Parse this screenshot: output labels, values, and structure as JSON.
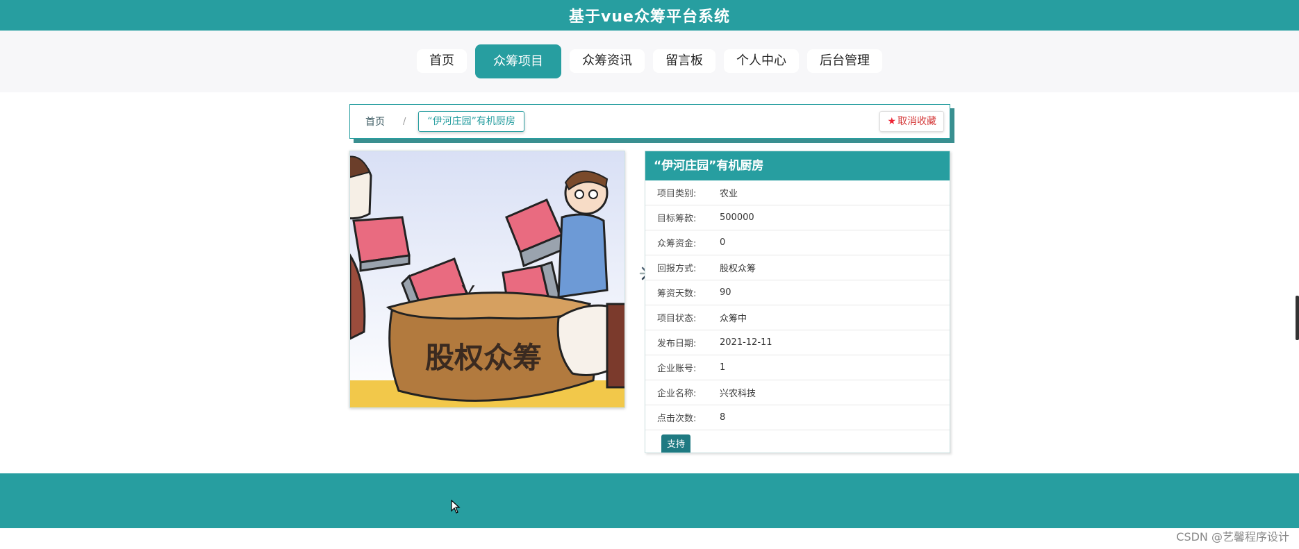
{
  "header": {
    "title": "基于vue众筹平台系统"
  },
  "nav": {
    "items": [
      "首页",
      "众筹项目",
      "众筹资讯",
      "留言板",
      "个人中心",
      "后台管理"
    ],
    "active": "众筹项目"
  },
  "breadcrumb": {
    "home": "首页",
    "separator": "/",
    "current": "“伊河庄园”有机厨房"
  },
  "favorite_button": "取消收藏",
  "image": {
    "caption_text": "股权众筹",
    "coin_symbol": "￥"
  },
  "detail": {
    "title": "“伊河庄园”有机厨房",
    "fields": [
      {
        "label": "项目类别:",
        "value": "农业"
      },
      {
        "label": "目标筹款:",
        "value": "500000"
      },
      {
        "label": "众筹资金:",
        "value": "0"
      },
      {
        "label": "回报方式:",
        "value": "股权众筹"
      },
      {
        "label": "筹资天数:",
        "value": "90"
      },
      {
        "label": "项目状态:",
        "value": "众筹中"
      },
      {
        "label": "发布日期:",
        "value": "2021-12-11"
      },
      {
        "label": "企业账号:",
        "value": "1"
      },
      {
        "label": "企业名称:",
        "value": "兴农科技"
      },
      {
        "label": "点击次数:",
        "value": "8"
      }
    ],
    "support_button": "支持"
  },
  "watermark": "CSDN @艺馨程序设计",
  "colors": {
    "primary": "#279ea0",
    "dark_button": "#1f7a82",
    "danger": "#d43a3a"
  }
}
